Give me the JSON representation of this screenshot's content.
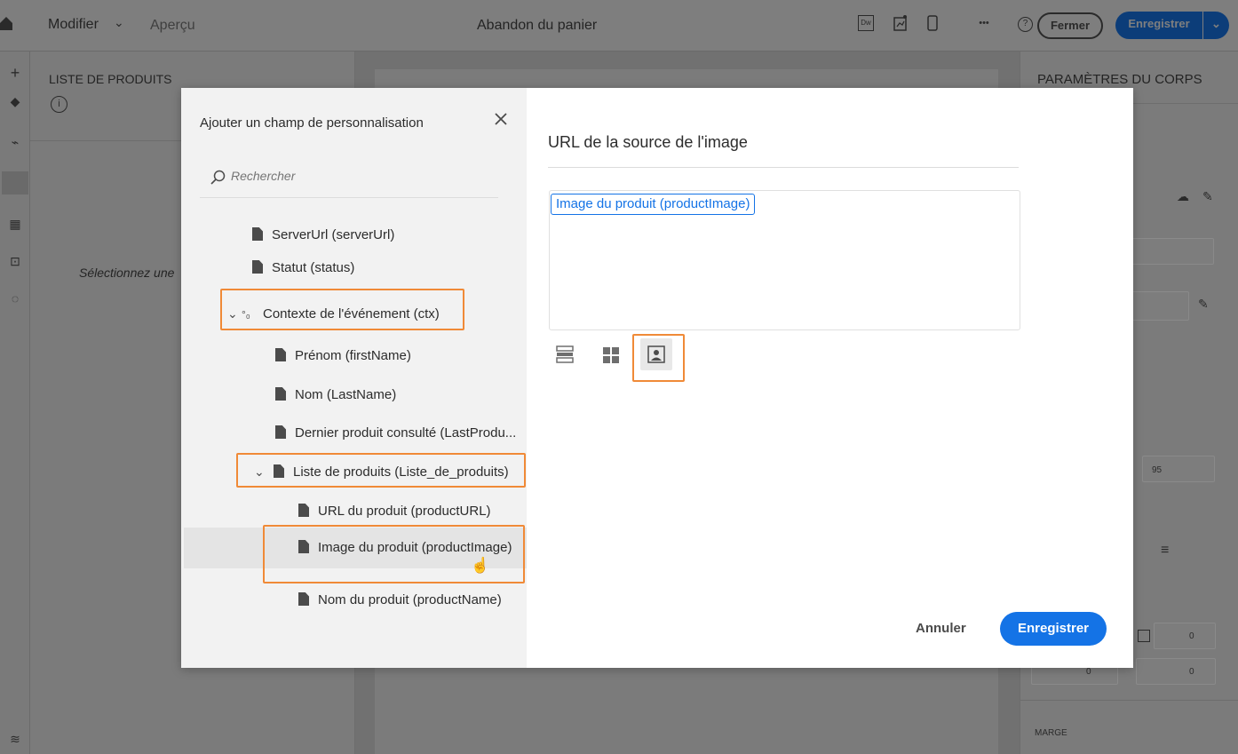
{
  "topbar": {
    "modifier_label": "Modifier",
    "apercu_label": "Aperçu",
    "title": "Abandon du panier",
    "dw_label": "Dw",
    "more_label": "•••",
    "help_label": "?",
    "fermer_label": "Fermer",
    "enregistrer_label": "Enregistrer"
  },
  "left_panel": {
    "title": "LISTE DE PRODUITS",
    "info_icon": "info-icon",
    "hint": "Sélectionnez une"
  },
  "right_panel": {
    "title": "PARAMÈTRES DU CORPS",
    "value_95": "95",
    "value_0a": "0",
    "value_0b": "0",
    "value_0c": "0",
    "marge_label": "MARGE"
  },
  "dialog": {
    "title": "Ajouter un champ de personnalisation",
    "search_placeholder": "Rechercher",
    "tree": [
      {
        "label": "ServerUrl (serverUrl)"
      },
      {
        "label": "Statut (status)"
      },
      {
        "label": "Contexte de l'événement (ctx)"
      },
      {
        "label": "Prénom (firstName)"
      },
      {
        "label": "Nom (LastName)"
      },
      {
        "label": "Dernier produit consulté (LastProdu..."
      },
      {
        "label": "Liste de produits (Liste_de_produits)"
      },
      {
        "label": "URL du produit (productURL)"
      },
      {
        "label": "Image du produit (productImage)"
      },
      {
        "label": "Nom du produit (productName)"
      }
    ],
    "right_title": "URL de la source de l'image",
    "token": "Image du produit (productImage)",
    "cancel_label": "Annuler",
    "save_label": "Enregistrer"
  },
  "colors": {
    "accent": "#1473e6",
    "highlight": "#f08a37",
    "overlay": "#7b7b7b"
  }
}
